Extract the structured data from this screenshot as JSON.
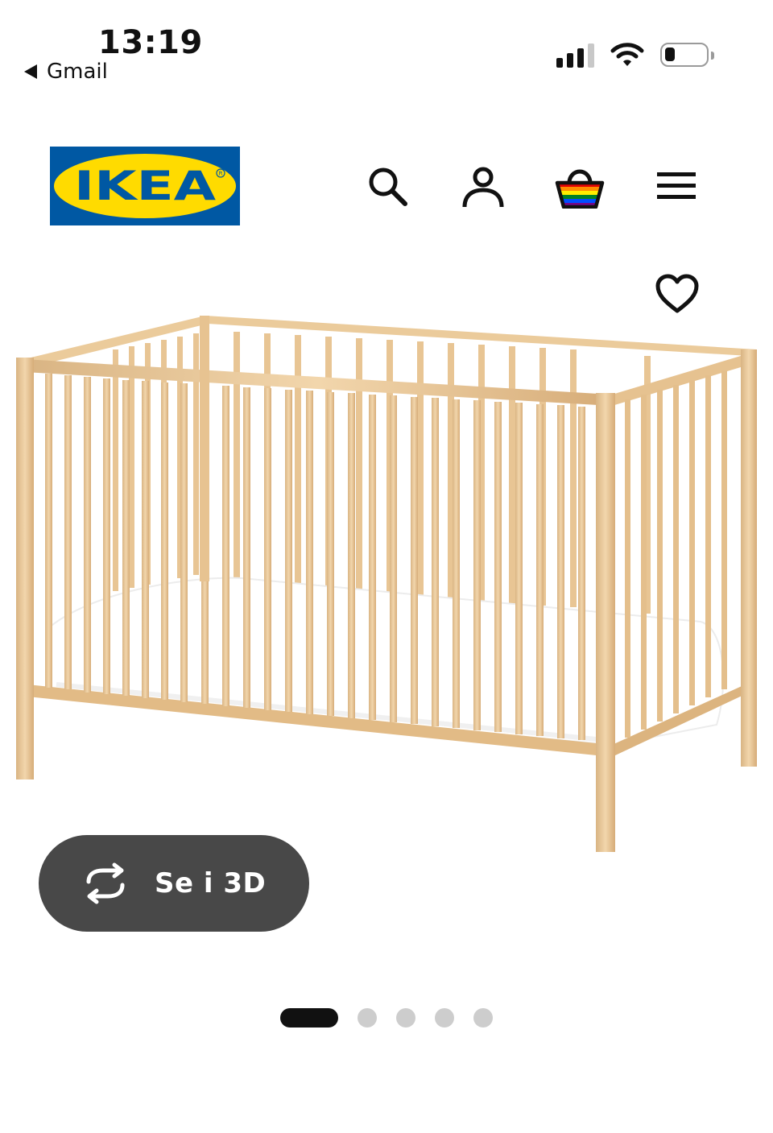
{
  "status_bar": {
    "time": "13:19",
    "back_app": "Gmail",
    "signal_bars": 4,
    "signal_bars_active": 3
  },
  "header": {
    "logo_text": "IKEA",
    "logo_colors": {
      "blue": "#0058a3",
      "yellow": "#ffdb00"
    },
    "icons": [
      "search-icon",
      "account-icon",
      "shopping-bag-icon",
      "menu-icon"
    ]
  },
  "product": {
    "wishlist_icon": "heart-icon",
    "view_3d_label": "Se i 3D",
    "view_3d_icon": "rotate-3d-icon"
  },
  "carousel": {
    "total": 5,
    "active_index": 0
  },
  "colors": {
    "button_bg": "#484848",
    "dot_active": "#111111",
    "dot_inactive": "#cdcdcd"
  }
}
